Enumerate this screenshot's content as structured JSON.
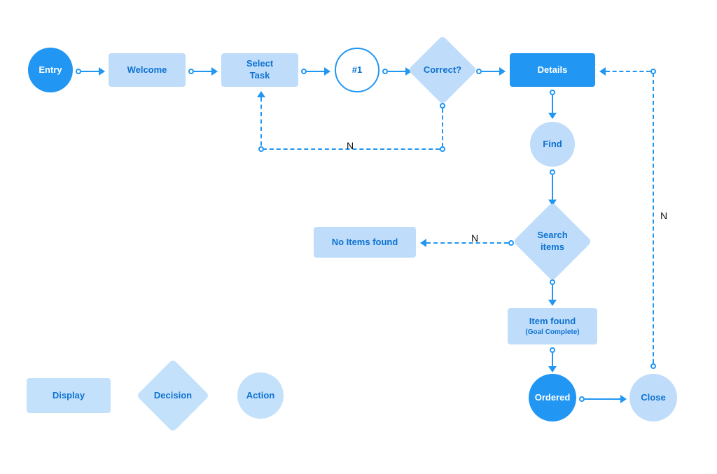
{
  "colors": {
    "accent": "#2196F3",
    "light": "#BFDDFA",
    "text": "#0E72D2"
  },
  "nodes": {
    "entry": "Entry",
    "welcome": "Welcome",
    "select_task": "Select\nTask",
    "ref1": "#1",
    "correct": "Correct?",
    "details": "Details",
    "find": "Find",
    "search_items": "Search\nitems",
    "no_items": "No Items found",
    "item_found_title": "Item found",
    "item_found_sub": "(Goal Complete)",
    "ordered": "Ordered",
    "close": "Close"
  },
  "edges": {
    "correct_no": "N",
    "search_no": "N",
    "close_no": "N"
  },
  "legend": {
    "display": "Display",
    "decision": "Decision",
    "action": "Action"
  }
}
